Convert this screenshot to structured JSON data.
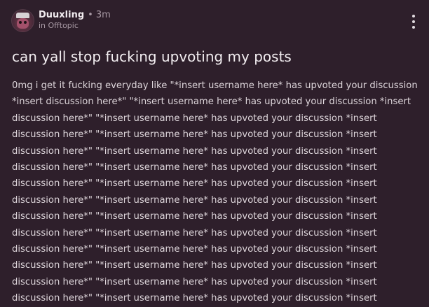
{
  "post": {
    "author": "Duuxling",
    "separator": "•",
    "time_ago": "3m",
    "community": "in Offtopic",
    "title": "can yall stop fucking upvoting my posts",
    "body_lines": [
      "0mg i get it fucking everyday like \"*insert username here* has upvoted your discussion",
      "*insert discussion here*\" \"*insert username here* has upvoted your discussion *insert",
      "discussion here*\" \"*insert username here* has upvoted your discussion *insert",
      "discussion here*\" \"*insert username here* has upvoted your discussion *insert",
      "discussion here*\" \"*insert username here* has upvoted your discussion *insert",
      "discussion here*\" \"*insert username here* has upvoted your discussion *insert",
      "discussion here*\" \"*insert username here* has upvoted your discussion *insert",
      "discussion here*\" \"*insert username here* has upvoted your discussion *insert",
      "discussion here*\" \"*insert username here* has upvoted your discussion *insert",
      "discussion here*\" \"*insert username here* has upvoted your discussion *insert",
      "discussion here*\" \"*insert username here* has upvoted your discussion *insert",
      "discussion here*\" \"*insert username here* has upvoted your discussion *insert",
      "discussion here*\" \"*insert username here* has upvoted your discussion *insert",
      "discussion here*\" \"*insert username here* has upvoted your discussion *insert"
    ]
  },
  "icons": {
    "avatar": "user-avatar",
    "more": "more-vertical-icon"
  },
  "colors": {
    "background": "#2e1f2b",
    "text_primary": "#f2edf0",
    "text_secondary": "#a99aa5"
  }
}
